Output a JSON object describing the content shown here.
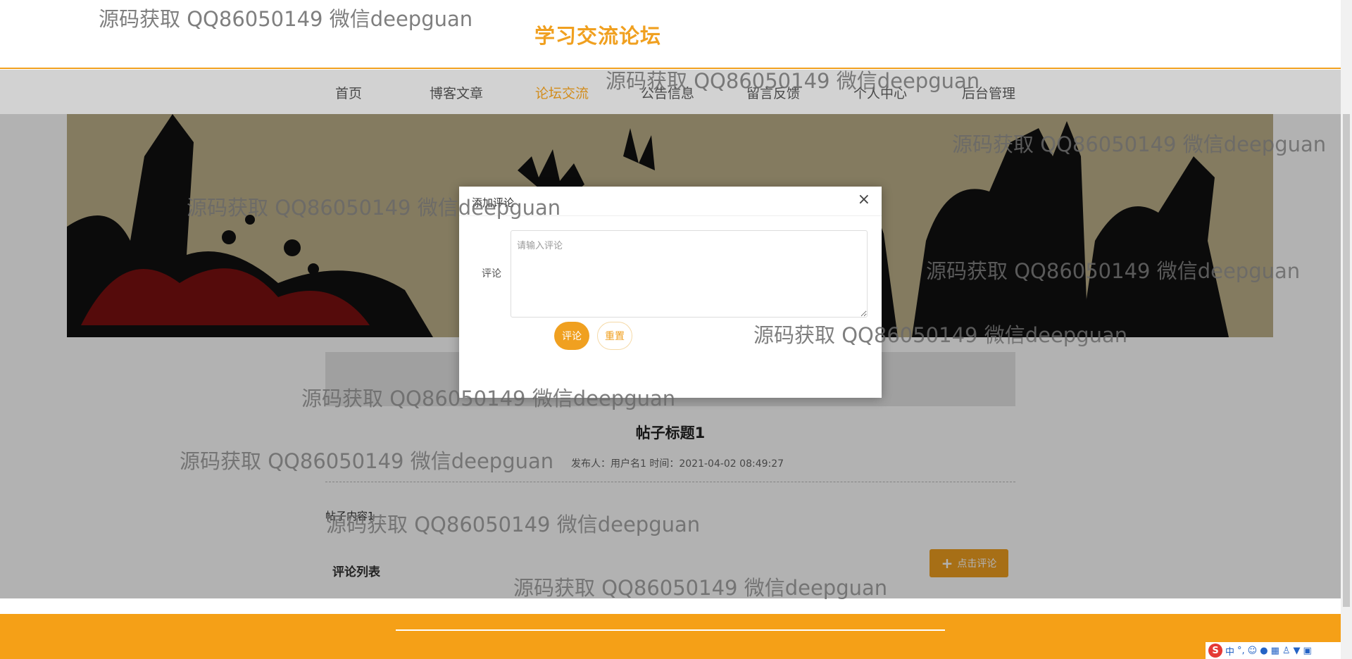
{
  "header": {
    "site_title": "学习交流论坛"
  },
  "nav": {
    "items": [
      {
        "label": "首页"
      },
      {
        "label": "博客文章"
      },
      {
        "label": "论坛交流",
        "active": true
      },
      {
        "label": "公告信息"
      },
      {
        "label": "留言反馈"
      },
      {
        "label": "个人中心"
      },
      {
        "label": "后台管理"
      }
    ]
  },
  "post": {
    "title": "帖子标题1",
    "meta": "发布人：用户名1 时间：2021-04-02 08:49:27",
    "content": "帖子内容1",
    "comment_list_title": "评论列表",
    "click_comment_label": "点击评论"
  },
  "dialog": {
    "title": "添加评论",
    "close": "×",
    "field_label": "评论",
    "placeholder": "请输入评论",
    "submit_label": "评论",
    "reset_label": "重置"
  },
  "watermark": {
    "text": "源码获取 QQ86050149 微信deepguan"
  },
  "tray": {
    "s": "S",
    "ime": "中",
    "punct": "°,"
  },
  "colors": {
    "accent": "#f0a020",
    "footer": "#f5a017"
  }
}
